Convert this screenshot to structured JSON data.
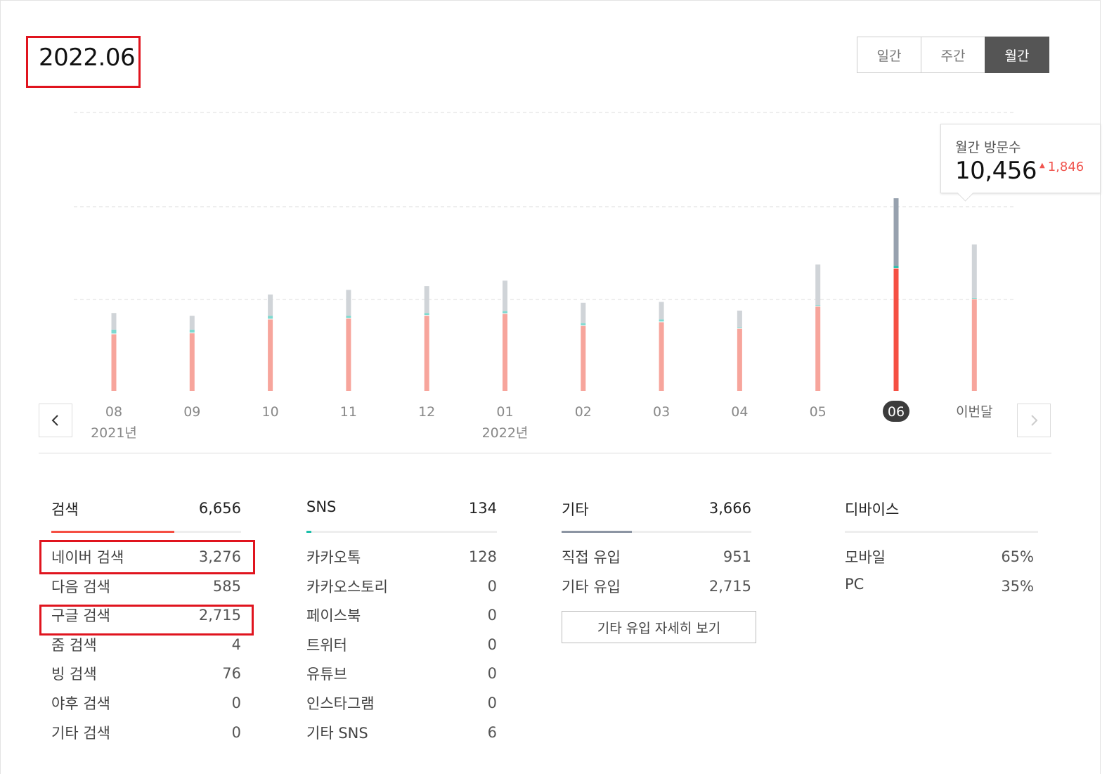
{
  "period": "2022.06",
  "view_toggle": [
    "일간",
    "주간",
    "월간"
  ],
  "selected_view": "월간",
  "tooltip": {
    "title": "월간 방문수",
    "value": "10,456",
    "delta": "1,846",
    "delta_icon": "up-triangle-icon"
  },
  "chart_data": {
    "type": "bar",
    "stacked": true,
    "grid": true,
    "categories": [
      "08",
      "09",
      "10",
      "11",
      "12",
      "01",
      "02",
      "03",
      "04",
      "05",
      "06",
      "이번달"
    ],
    "year_labels": [
      {
        "category": "08",
        "text": "2021년"
      },
      {
        "category": "01",
        "text": "2022년"
      }
    ],
    "selected_category": "06",
    "series": [
      {
        "name": "검색",
        "color": "#f7a59c",
        "highlight_color": "#f54f43",
        "values": [
          3100,
          3150,
          3900,
          3950,
          4100,
          4200,
          3550,
          3750,
          3400,
          4600,
          6656,
          5000
        ]
      },
      {
        "name": "SNS",
        "color": "#7ed9cf",
        "highlight_color": "#1cbfaa",
        "values": [
          250,
          200,
          200,
          150,
          150,
          150,
          150,
          150,
          80,
          70,
          134,
          60
        ]
      },
      {
        "name": "기타",
        "color": "#d0d4d8",
        "highlight_color": "#97a1ae",
        "values": [
          900,
          750,
          1150,
          1400,
          1450,
          1650,
          1100,
          950,
          900,
          2200,
          3666,
          2900
        ]
      }
    ]
  },
  "search": {
    "title": "검색",
    "total": "6,656",
    "share": 0.648,
    "color": "#f54f43",
    "rows": [
      {
        "label": "네이버 검색",
        "value": "3,276"
      },
      {
        "label": "다음 검색",
        "value": "585"
      },
      {
        "label": "구글 검색",
        "value": "2,715"
      },
      {
        "label": "줌 검색",
        "value": "4"
      },
      {
        "label": "빙 검색",
        "value": "76"
      },
      {
        "label": "야후 검색",
        "value": "0"
      },
      {
        "label": "기타 검색",
        "value": "0"
      }
    ]
  },
  "sns": {
    "title": "SNS",
    "total": "134",
    "share": 0.025,
    "color": "#1cbfaa",
    "rows": [
      {
        "label": "카카오톡",
        "value": "128"
      },
      {
        "label": "카카오스토리",
        "value": "0"
      },
      {
        "label": "페이스북",
        "value": "0"
      },
      {
        "label": "트위터",
        "value": "0"
      },
      {
        "label": "유튜브",
        "value": "0"
      },
      {
        "label": "인스타그램",
        "value": "0"
      },
      {
        "label": "기타 SNS",
        "value": "6"
      }
    ]
  },
  "other": {
    "title": "기타",
    "total": "3,666",
    "share": 0.37,
    "color": "#8c95a3",
    "rows": [
      {
        "label": "직접 유입",
        "value": "951"
      },
      {
        "label": "기타 유입",
        "value": "2,715"
      }
    ],
    "detail_button": "기타 유입 자세히 보기"
  },
  "device": {
    "title": "디바이스",
    "rows": [
      {
        "label": "모바일",
        "value": "65%"
      },
      {
        "label": "PC",
        "value": "35%"
      }
    ]
  },
  "highlight_color": "#e0141e"
}
